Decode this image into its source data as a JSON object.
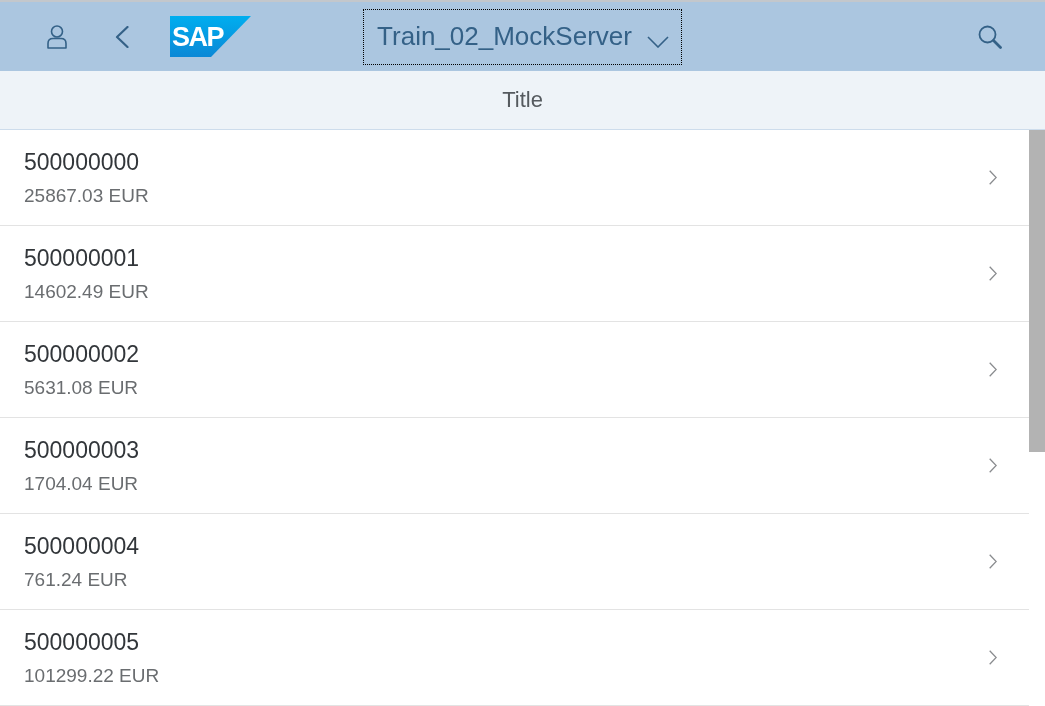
{
  "shell_bar": {
    "logo_text": "SAP",
    "title": "Train_02_MockServer",
    "title_focused": true
  },
  "page_header": {
    "title": "Title"
  },
  "list": {
    "items": [
      {
        "title": "500000000",
        "description": "25867.03 EUR"
      },
      {
        "title": "500000001",
        "description": "14602.49 EUR"
      },
      {
        "title": "500000002",
        "description": "5631.08 EUR"
      },
      {
        "title": "500000003",
        "description": "1704.04 EUR"
      },
      {
        "title": "500000004",
        "description": "761.24 EUR"
      },
      {
        "title": "500000005",
        "description": "101299.22 EUR"
      }
    ]
  }
}
